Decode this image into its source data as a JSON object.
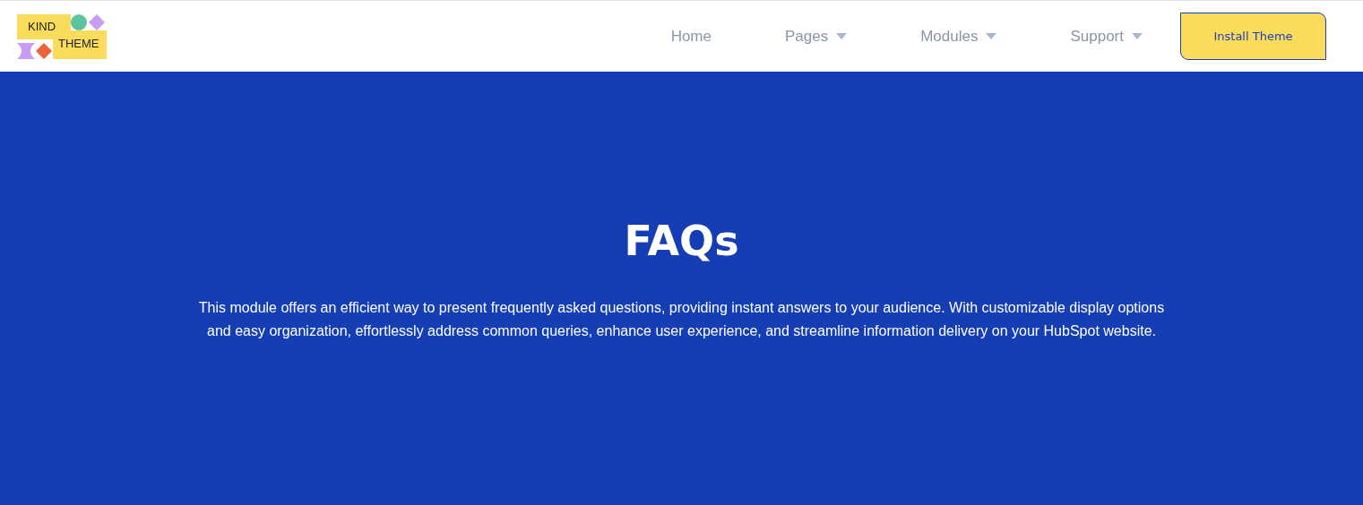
{
  "logo": {
    "line_1": "KIND",
    "line_2": "THEME"
  },
  "nav": [
    {
      "label": "Home",
      "kind": "link"
    },
    {
      "label": "Pages",
      "kind": "dropdown"
    },
    {
      "label": "Modules",
      "kind": "dropdown"
    },
    {
      "label": "Support",
      "kind": "dropdown"
    }
  ],
  "cta_button": "Install Theme",
  "hero": {
    "title": "FAQs",
    "description": "This module offers an efficient way to present frequently asked questions, providing instant answers to your audience. With customizable display options and easy organization, effortlessly address common queries, enhance user experience, and streamline information delivery on your HubSpot website."
  }
}
